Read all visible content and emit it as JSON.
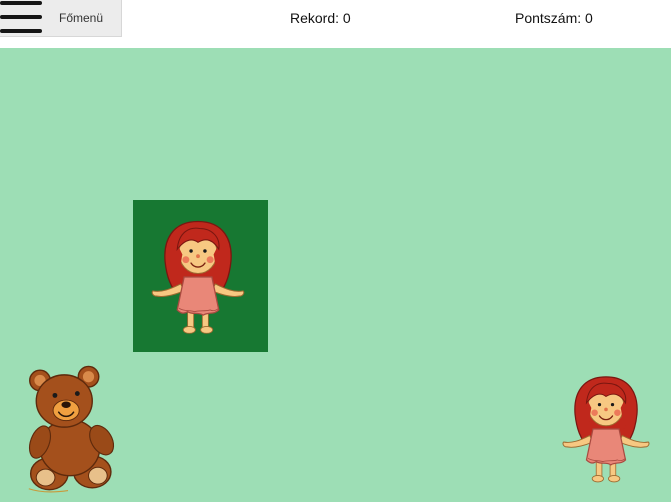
{
  "header": {
    "menu_label": "Főmenü",
    "record_label": "Rekord: 0",
    "score_label": "Pontszám: 0"
  },
  "icons": {
    "menu": "hamburger-icon",
    "card_item": "doll-icon",
    "bottom_left": "teddy-bear-icon",
    "bottom_right": "doll-icon"
  },
  "colors": {
    "field": "#9ddeb5",
    "card": "#177832",
    "doll_hair": "#c0281c",
    "doll_dress": "#e98778",
    "bear": "#a4501c"
  }
}
